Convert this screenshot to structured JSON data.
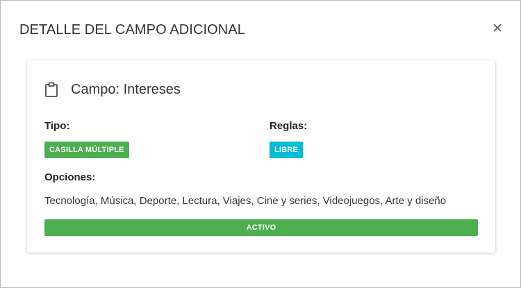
{
  "modal": {
    "title": "DETALLE DEL CAMPO ADICIONAL",
    "close_icon": "close-icon"
  },
  "card": {
    "icon": "clipboard-icon",
    "title": "Campo: Intereses",
    "tipo_label": "Tipo:",
    "tipo_value": "CASILLA MÚLTIPLE",
    "reglas_label": "Reglas:",
    "reglas_value": "LIBRE",
    "opciones_label": "Opciones:",
    "opciones_value": "Tecnología, Música, Deporte, Lectura, Viajes, Cine y series, Videojuegos, Arte y diseño",
    "status": "ACTIVO"
  },
  "colors": {
    "success": "#4caf50",
    "info": "#00bcd4"
  }
}
